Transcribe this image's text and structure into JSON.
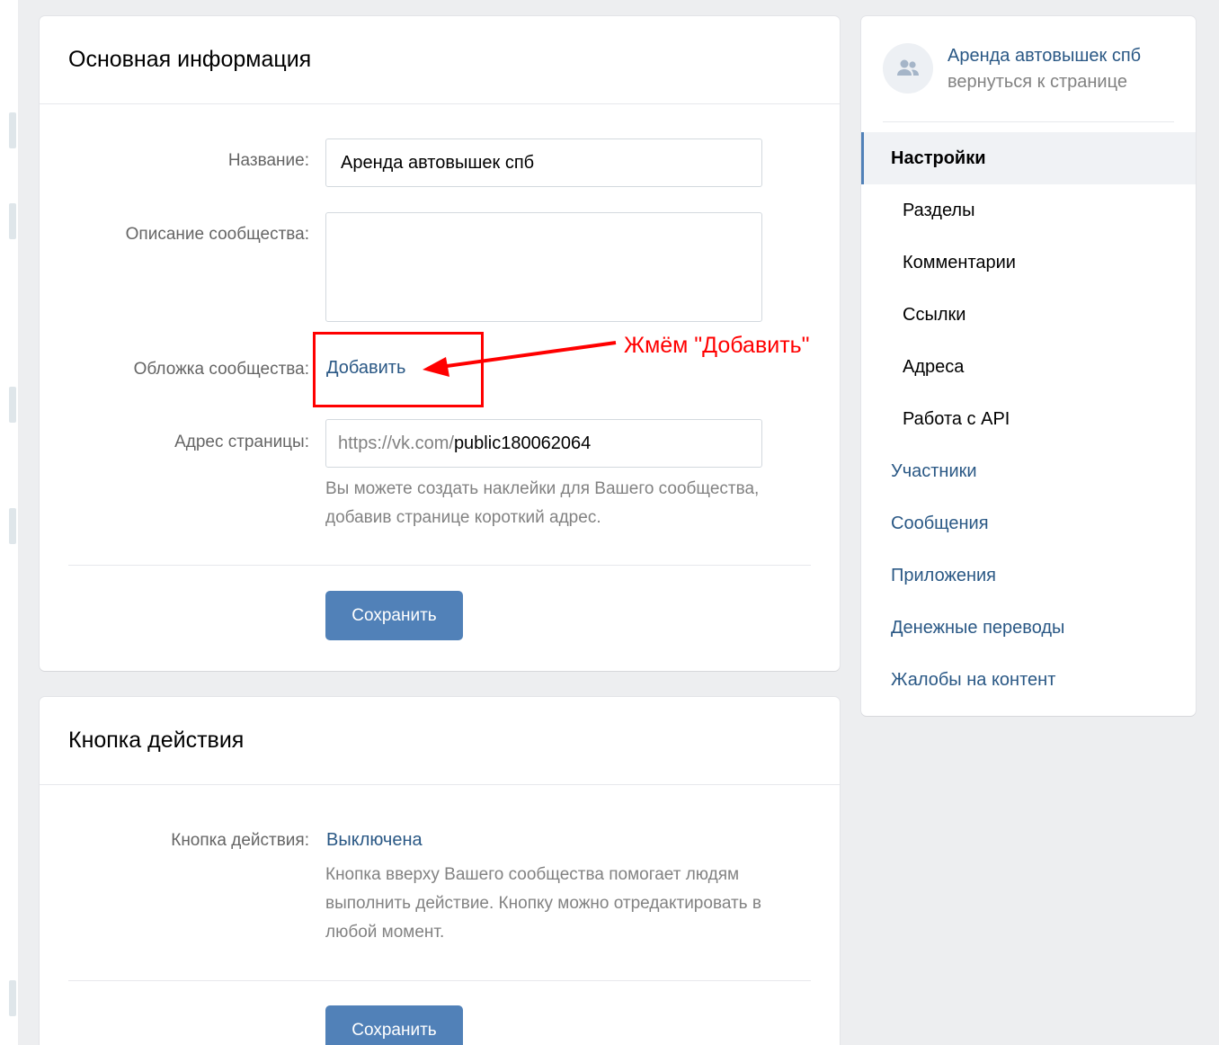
{
  "main_card": {
    "title": "Основная информация",
    "name_label": "Название:",
    "name_value": "Аренда автовышек спб",
    "description_label": "Описание сообщества:",
    "description_value": "",
    "cover_label": "Обложка сообщества:",
    "cover_link": "Добавить",
    "address_label": "Адрес страницы:",
    "address_prefix": "https://vk.com/",
    "address_value": "public180062064",
    "address_hint_line1": "Вы можете создать наклейки для Вашего сообщества,",
    "address_hint_line2": "добавив странице короткий адрес.",
    "save_label": "Сохранить"
  },
  "annotation": {
    "text": "Жмём \"Добавить\"",
    "color": "#ff0000"
  },
  "action_card": {
    "title": "Кнопка действия",
    "action_label": "Кнопка действия:",
    "action_value": "Выключена",
    "hint_line1": "Кнопка вверху Вашего сообщества помогает людям",
    "hint_line2": "выполнить действие. Кнопку можно отредактировать в",
    "hint_line3": "любой момент.",
    "save_label": "Сохранить"
  },
  "sidebar": {
    "community_name": "Аренда автовышек спб",
    "back_link": "вернуться к странице",
    "avatar_icon": "community-icon",
    "items": [
      {
        "label": "Настройки",
        "active": true,
        "level": "main"
      },
      {
        "label": "Разделы",
        "active": false,
        "level": "sub"
      },
      {
        "label": "Комментарии",
        "active": false,
        "level": "sub"
      },
      {
        "label": "Ссылки",
        "active": false,
        "level": "sub"
      },
      {
        "label": "Адреса",
        "active": false,
        "level": "sub"
      },
      {
        "label": "Работа с API",
        "active": false,
        "level": "sub"
      },
      {
        "label": "Участники",
        "active": false,
        "level": "main"
      },
      {
        "label": "Сообщения",
        "active": false,
        "level": "main"
      },
      {
        "label": "Приложения",
        "active": false,
        "level": "main"
      },
      {
        "label": "Денежные переводы",
        "active": false,
        "level": "main"
      },
      {
        "label": "Жалобы на контент",
        "active": false,
        "level": "main"
      }
    ]
  },
  "colors": {
    "accent": "#5181b8",
    "link": "#2a5885",
    "background": "#edeef0"
  }
}
